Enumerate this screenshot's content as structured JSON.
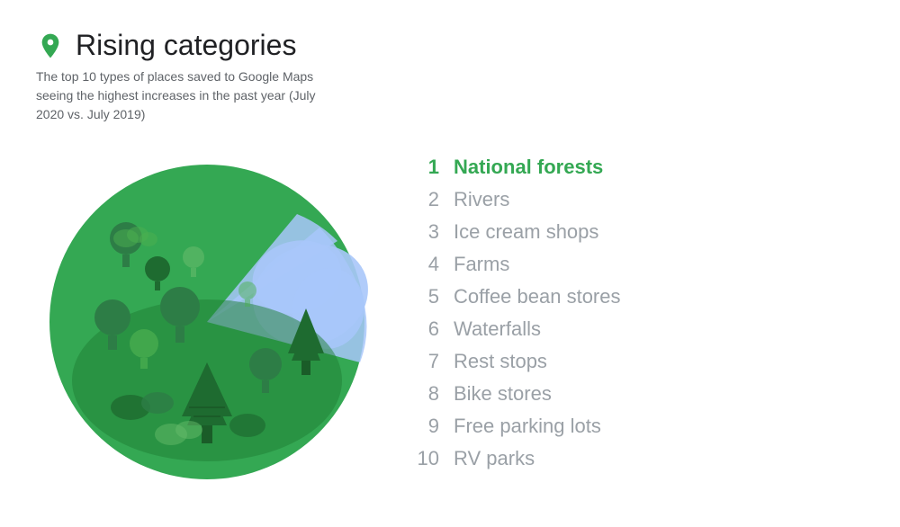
{
  "header": {
    "title": "Rising categories",
    "subtitle": "The top 10 types of places saved to Google Maps seeing the highest increases in the past year (July 2020 vs. July 2019)"
  },
  "list": {
    "items": [
      {
        "rank": "1",
        "label": "National forests",
        "highlight": true
      },
      {
        "rank": "2",
        "label": "Rivers",
        "highlight": false
      },
      {
        "rank": "3",
        "label": "Ice cream shops",
        "highlight": false
      },
      {
        "rank": "4",
        "label": "Farms",
        "highlight": false
      },
      {
        "rank": "5",
        "label": "Coffee bean stores",
        "highlight": false
      },
      {
        "rank": "6",
        "label": "Waterfalls",
        "highlight": false
      },
      {
        "rank": "7",
        "label": "Rest stops",
        "highlight": false
      },
      {
        "rank": "8",
        "label": "Bike stores",
        "highlight": false
      },
      {
        "rank": "9",
        "label": "Free parking lots",
        "highlight": false
      },
      {
        "rank": "10",
        "label": "RV parks",
        "highlight": false
      }
    ]
  },
  "colors": {
    "green_dark": "#2d7d46",
    "green_medium": "#34a853",
    "green_light": "#81c995",
    "blue_light": "#a8c7fa",
    "pin": "#34a853"
  }
}
